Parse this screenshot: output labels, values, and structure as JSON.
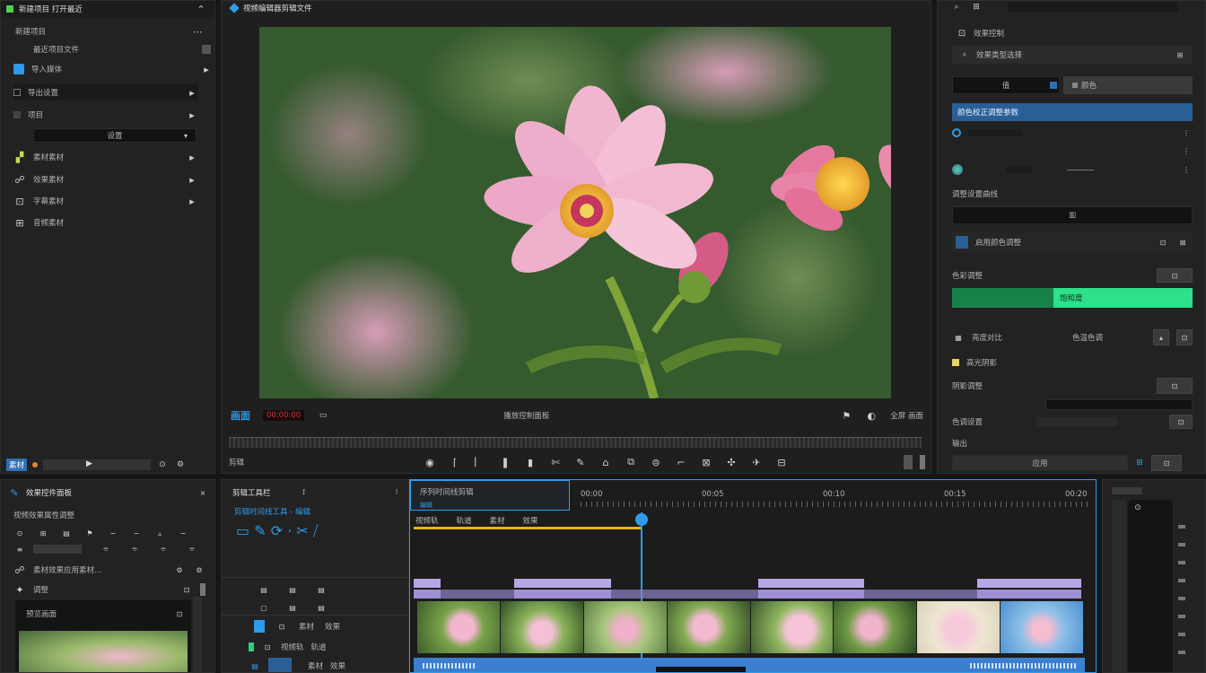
{
  "colors": {
    "accent": "#2f9bea",
    "green": "#1db46a",
    "clip_purple": "#b7a6e6",
    "audio_blue": "#3a7fd0",
    "playhead_yellow": "#e3b51a"
  },
  "left_panel": {
    "title": "新建项目 打开最近",
    "items": [
      {
        "label": "新建项目",
        "icon": "square-icon"
      },
      {
        "label": "最近项目文件",
        "icon": "clock-icon"
      },
      {
        "label": "导入媒体",
        "icon": "import-icon"
      },
      {
        "label": "导出设置",
        "icon": "export-icon"
      },
      {
        "label": "项目",
        "icon": "dot-icon"
      },
      {
        "label": "素材素材",
        "icon": "chart-icon"
      },
      {
        "label": "效果素材",
        "icon": "effect-icon"
      },
      {
        "label": "字幕素材",
        "icon": "text-icon"
      },
      {
        "label": "音频素材",
        "icon": "audio-icon"
      }
    ],
    "field_value": "设置",
    "footer_badge": "素材"
  },
  "viewer": {
    "title": "视频编辑器剪辑文件",
    "timecode": "00:00:00",
    "status_label": "画面",
    "center_label": "播放控制面板",
    "right_label": "全屏 画面",
    "bottom_label": "剪辑"
  },
  "right_panel": {
    "header": "效果控制",
    "dropdown": "效果类型选择",
    "tab": "颜色",
    "highlight": "颜色校正调整参数",
    "section1": "调整设置曲线",
    "field1": "值",
    "checkbox_label": "启用颜色调整",
    "section2": "色彩调整",
    "progress_label": "饱和度",
    "progress_value": 0.42,
    "row1": "亮度对比",
    "row1_value": "色温色调",
    "row2": "高光阴影",
    "row3": "阴影调整",
    "row4": "色调设置",
    "row5": "输出",
    "bottom_btn": "应用"
  },
  "bottom_left": {
    "title": "效果控件面板",
    "subtitle": "视频效果属性调整",
    "items": [
      {
        "label": "素材效果应用素材..."
      },
      {
        "label": "调整"
      },
      {
        "label": "预览画面"
      }
    ]
  },
  "tools_panel": {
    "title": "剪辑工具栏",
    "subtitle": "剪辑时间线工具 - 编辑",
    "glyphs": "▭  ✎  ⟳ · ✂ ⧸"
  },
  "timeline": {
    "sequence_tab": "序列时间线剪辑",
    "sub_tab": "编辑",
    "ruler_labels": [
      "00:00",
      "00:05",
      "00:10",
      "00:15",
      "00:20"
    ],
    "track_labels": [
      "视频轨",
      "轨道",
      "素材",
      "效果"
    ],
    "clips": [
      "clip-1",
      "clip-2",
      "clip-3",
      "clip-4"
    ]
  }
}
